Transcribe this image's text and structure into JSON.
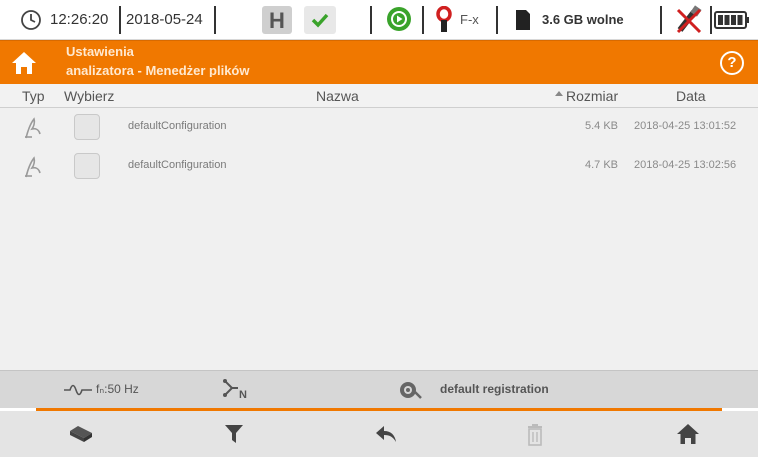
{
  "status": {
    "time": "12:26:20",
    "date": "2018-05-24",
    "clamp_label": "F-x",
    "free_space": "3.6 GB wolne",
    "icons": [
      "clock-icon",
      "save-icon",
      "check-icon",
      "play-icon",
      "clamp-icon",
      "sd-card-icon",
      "usb-icon",
      "battery-icon"
    ]
  },
  "header": {
    "title_line1": "Ustawienia",
    "title_line2": "analizatora - Menedżer plików",
    "help": "?"
  },
  "columns": {
    "type": "Typ",
    "select": "Wybierz",
    "name": "Nazwa",
    "size": "Rozmiar",
    "date": "Data"
  },
  "files": [
    {
      "name": "defaultConfiguration",
      "size": "5.4 KB",
      "date": "2018-04-25 13:01:52"
    },
    {
      "name": "defaultConfiguration",
      "size": "4.7 KB",
      "date": "2018-04-25 13:02:56"
    }
  ],
  "info": {
    "frequency": "fₙ:50 Hz",
    "registration": "default registration"
  },
  "colors": {
    "accent": "#f07800",
    "header_text": "#ffe9d0",
    "list_bg": "#f0f0f0",
    "toolbar_bg": "#e4e4e4"
  }
}
